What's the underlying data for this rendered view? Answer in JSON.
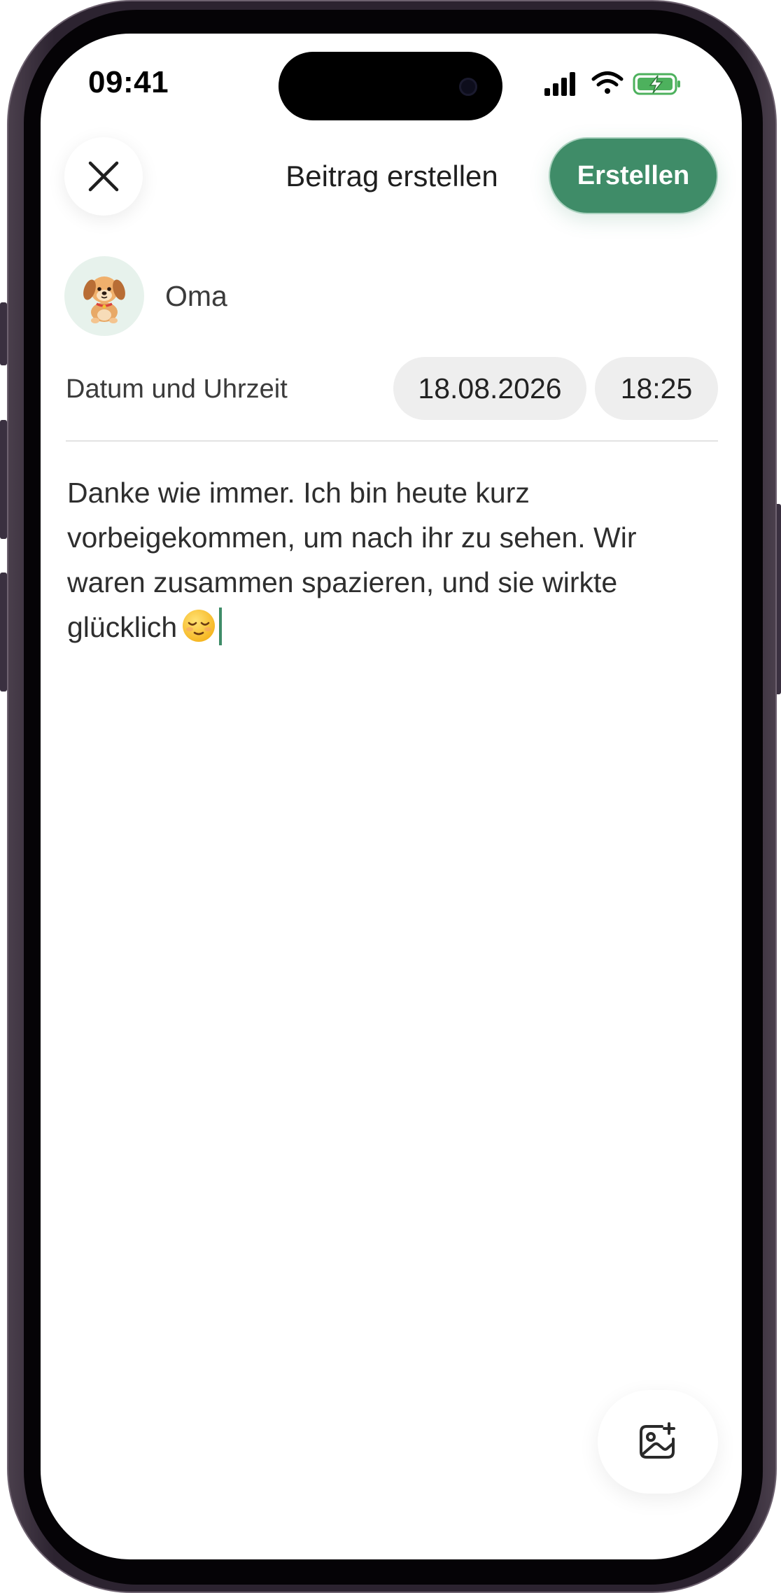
{
  "status_bar": {
    "time": "09:41",
    "icons": [
      "cellular-signal-icon",
      "wifi-icon",
      "battery-charging-icon"
    ]
  },
  "header": {
    "title": "Beitrag erstellen",
    "create_label": "Erstellen",
    "close_icon": "close-icon"
  },
  "author": {
    "name": "Oma",
    "avatar_icon": "puppy-avatar-icon"
  },
  "datetime": {
    "label": "Datum und Uhrzeit",
    "date": "18.08.2026",
    "time": "18:25"
  },
  "post": {
    "text": "Danke wie immer. Ich bin heute kurz vorbeigekommen, um nach ihr zu sehen. Wir waren zusammen spazieren, und sie wirkte glücklich",
    "emoji": "relieved-face-emoji"
  },
  "media": {
    "icon": "add-image-icon"
  },
  "colors": {
    "accent": "#3f8c68",
    "pill_bg": "#eeeeee",
    "avatar_bg": "#e7f2ec"
  }
}
